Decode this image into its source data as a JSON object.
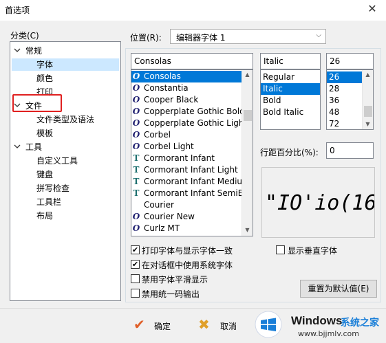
{
  "window": {
    "title": "首选项",
    "close_glyph": "✕"
  },
  "left": {
    "group_label": "分类(C)",
    "tree": [
      {
        "label": "常规",
        "expanded": true
      },
      {
        "label": "字体",
        "selected": true
      },
      {
        "label": "颜色"
      },
      {
        "label": "打印"
      },
      {
        "label": "文件",
        "expanded": true
      },
      {
        "label": "文件类型及语法"
      },
      {
        "label": "模板"
      },
      {
        "label": "工具",
        "expanded": true
      },
      {
        "label": "自定义工具"
      },
      {
        "label": "键盘"
      },
      {
        "label": "拼写检查"
      },
      {
        "label": "工具栏"
      },
      {
        "label": "布局"
      }
    ]
  },
  "position": {
    "label": "位置(R):",
    "value": "编辑器字体 1"
  },
  "font": {
    "name_value": "Consolas",
    "style_value": "Italic",
    "size_value": "26",
    "names": [
      {
        "label": "Consolas",
        "icon": "O",
        "selected": true
      },
      {
        "label": "Constantia",
        "icon": "O"
      },
      {
        "label": "Cooper Black",
        "icon": "O"
      },
      {
        "label": "Copperplate Gothic Bold",
        "icon": "O"
      },
      {
        "label": "Copperplate Gothic Light",
        "icon": "O"
      },
      {
        "label": "Corbel",
        "icon": "O"
      },
      {
        "label": "Corbel Light",
        "icon": "O"
      },
      {
        "label": "Cormorant Infant",
        "icon": "T"
      },
      {
        "label": "Cormorant Infant Light",
        "icon": "T"
      },
      {
        "label": "Cormorant Infant Medium",
        "icon": "T"
      },
      {
        "label": "Cormorant Infant SemiBold",
        "icon": "T"
      },
      {
        "label": "Courier",
        "icon": ""
      },
      {
        "label": "Courier New",
        "icon": "O"
      },
      {
        "label": "Curlz MT",
        "icon": "O"
      }
    ],
    "styles": [
      {
        "label": "Regular"
      },
      {
        "label": "Italic",
        "selected": true
      },
      {
        "label": "Bold"
      },
      {
        "label": "Bold Italic"
      }
    ],
    "sizes": [
      {
        "label": "26",
        "selected": true
      },
      {
        "label": "28"
      },
      {
        "label": "36"
      },
      {
        "label": "48"
      },
      {
        "label": "72"
      }
    ]
  },
  "line_spacing": {
    "label": "行距百分比(%):",
    "value": "0"
  },
  "preview": {
    "text": "\"IO'io(16"
  },
  "options": [
    {
      "label": "打印字体与显示字体一致",
      "checked": true
    },
    {
      "label": "在对话框中使用系统字体",
      "checked": true
    },
    {
      "label": "禁用字体平滑显示",
      "checked": false
    },
    {
      "label": "禁用统一码输出",
      "checked": false
    }
  ],
  "vertical_font": {
    "label": "显示垂直字体",
    "checked": false
  },
  "buttons": {
    "reset": "重置为默认值(E)",
    "ok": "确定",
    "cancel": "取消"
  },
  "watermark": {
    "brand": "Windows",
    "suffix": "系统之家",
    "url": "www.bjjmlv.com"
  },
  "highlight_color": "#e02020"
}
